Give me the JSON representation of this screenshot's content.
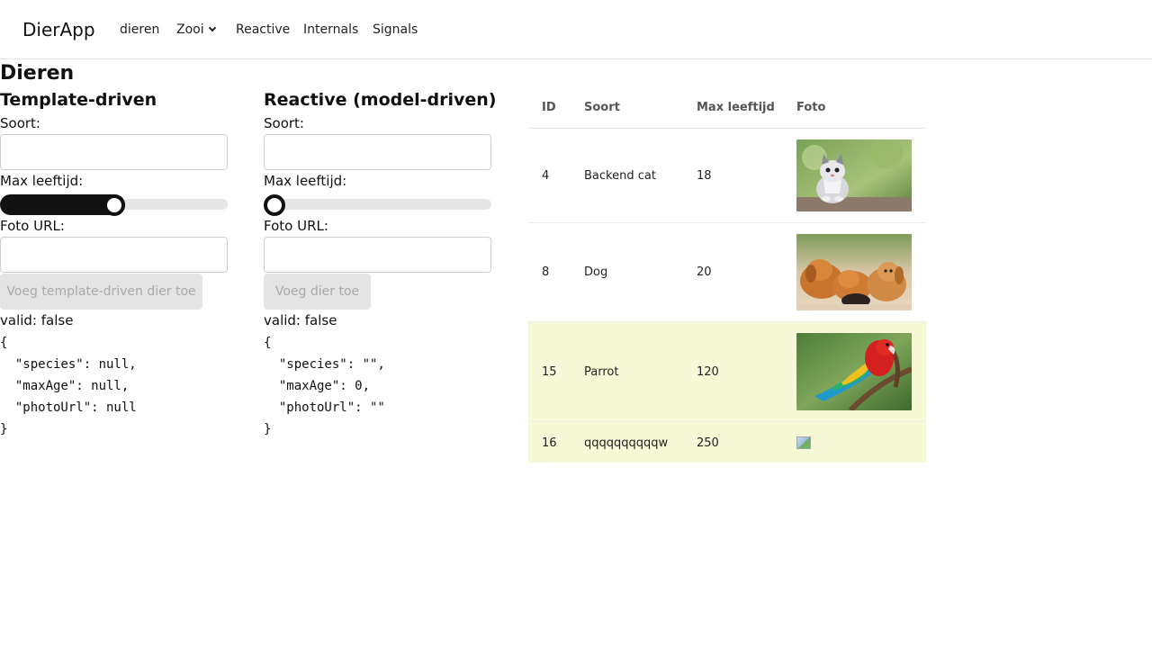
{
  "navbar": {
    "brand": "DierApp",
    "links": [
      "dieren",
      "Zooi",
      "Reactive",
      "Internals",
      "Signals"
    ]
  },
  "page_title": "Dieren",
  "template_form": {
    "title": "Template-driven",
    "species_label": "Soort:",
    "species_value": "",
    "max_age_label": "Max leeftijd:",
    "max_age_fraction": 0.5,
    "photo_label": "Foto URL:",
    "photo_value": "",
    "submit_label": "Voeg template-driven dier toe",
    "valid_text": "valid: false",
    "json_text": "{\n  \"species\": null,\n  \"maxAge\": null,\n  \"photoUrl\": null\n}"
  },
  "reactive_form": {
    "title": "Reactive (model-driven)",
    "species_label": "Soort:",
    "species_value": "",
    "max_age_label": "Max leeftijd:",
    "max_age_fraction": 0,
    "photo_label": "Foto URL:",
    "photo_value": "",
    "submit_label": "Voeg dier toe",
    "valid_text": "valid: false",
    "json_text": "{\n  \"species\": \"\",\n  \"maxAge\": 0,\n  \"photoUrl\": \"\"\n}"
  },
  "table": {
    "headers": [
      "ID",
      "Soort",
      "Max leeftijd",
      "Foto"
    ],
    "rows": [
      {
        "id": "4",
        "species": "Backend cat",
        "max_age": "18",
        "photo": "kitten-photo",
        "highlight": false
      },
      {
        "id": "8",
        "species": "Dog",
        "max_age": "20",
        "photo": "puppies-photo",
        "highlight": false
      },
      {
        "id": "15",
        "species": "Parrot",
        "max_age": "120",
        "photo": "parrot-photo",
        "highlight": true
      },
      {
        "id": "16",
        "species": "qqqqqqqqqqw",
        "max_age": "250",
        "photo": "broken-image-icon",
        "highlight": true
      }
    ]
  },
  "colors": {
    "highlight_row": "#f7f8d5",
    "slider_fill": "#111111",
    "button_disabled_bg": "#e4e4e4"
  }
}
